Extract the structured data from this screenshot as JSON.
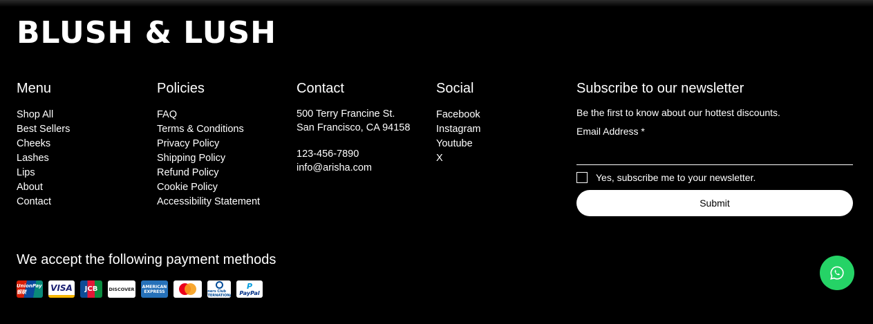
{
  "brand": {
    "name": "BLUSH & LUSH"
  },
  "menu": {
    "heading": "Menu",
    "items": [
      "Shop All",
      "Best Sellers",
      "Cheeks",
      "Lashes",
      "Lips",
      "About",
      "Contact"
    ]
  },
  "policies": {
    "heading": "Policies",
    "items": [
      "FAQ",
      "Terms & Conditions",
      "Privacy Policy",
      "Shipping Policy",
      "Refund Policy",
      "Cookie Policy",
      "Accessibility Statement"
    ]
  },
  "contact": {
    "heading": "Contact",
    "address_line1": "500 Terry Francine St.",
    "address_line2": "San Francisco, CA 94158",
    "phone": "123-456-7890",
    "email": "info@arisha.com"
  },
  "social": {
    "heading": "Social",
    "items": [
      "Facebook",
      "Instagram",
      "Youtube",
      "X"
    ]
  },
  "newsletter": {
    "heading": "Subscribe to our newsletter",
    "description": "Be the first to know about our hottest discounts.",
    "email_label": "Email Address *",
    "email_value": "",
    "checkbox_label": "Yes, subscribe me to your newsletter.",
    "checkbox_checked": false,
    "submit_label": "Submit"
  },
  "payments": {
    "heading": "We accept the following payment methods",
    "cards": [
      {
        "name": "UnionPay",
        "label": "UnionPay 银联",
        "icon": "unionpay-icon"
      },
      {
        "name": "Visa",
        "label": "VISA",
        "icon": "visa-icon"
      },
      {
        "name": "JCB",
        "label": "JCB",
        "icon": "jcb-icon"
      },
      {
        "name": "Discover",
        "label": "DISCOVER",
        "icon": "discover-icon"
      },
      {
        "name": "American Express",
        "label": "AMERICAN EXPRESS",
        "icon": "amex-icon"
      },
      {
        "name": "Mastercard",
        "label": "",
        "icon": "mastercard-icon"
      },
      {
        "name": "Diners Club",
        "label": "Diners Club INTERNATIONAL",
        "icon": "diners-club-icon"
      },
      {
        "name": "PayPal",
        "label": "PayPal",
        "icon": "paypal-icon"
      }
    ]
  },
  "colors": {
    "background": "#000000",
    "text": "#ffffff",
    "whatsapp": "#25d366"
  },
  "chat_button": {
    "icon": "whatsapp-icon"
  }
}
